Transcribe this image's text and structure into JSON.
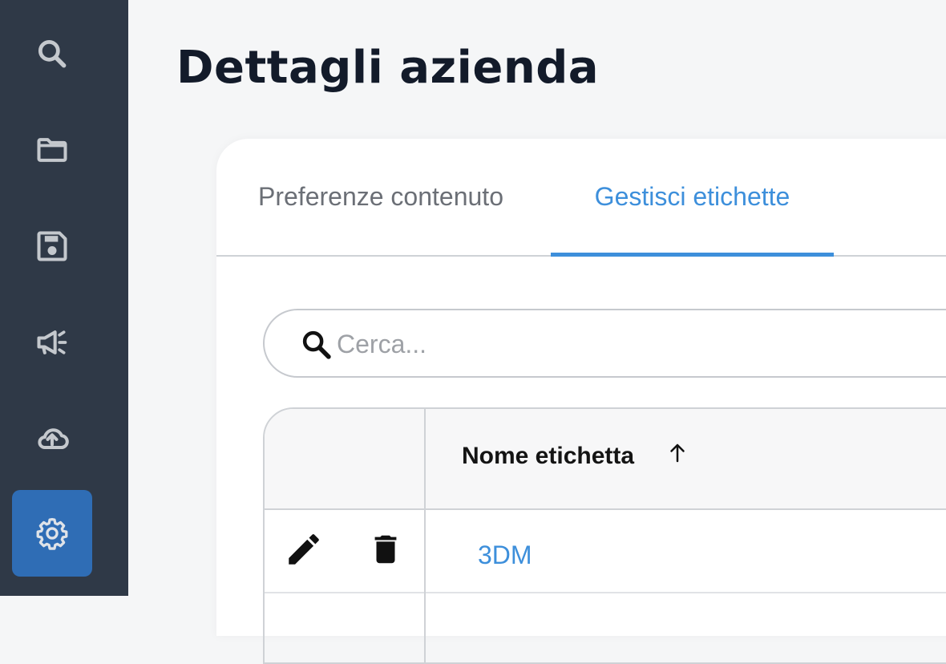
{
  "sidebar": {
    "items": [
      {
        "icon": "search-icon",
        "active": false
      },
      {
        "icon": "folder-icon",
        "active": false
      },
      {
        "icon": "save-icon",
        "active": false
      },
      {
        "icon": "megaphone-icon",
        "active": false
      },
      {
        "icon": "cloud-upload-icon",
        "active": false
      },
      {
        "icon": "gear-icon",
        "active": true
      }
    ],
    "colors": {
      "background": "#2f3947",
      "active": "#2f6db5",
      "icon": "#c4c8cd"
    }
  },
  "page": {
    "title": "Dettagli azienda"
  },
  "tabs": [
    {
      "label": "Preferenze contenuto",
      "active": false
    },
    {
      "label": "Gestisci etichette",
      "active": true
    }
  ],
  "search": {
    "placeholder": "Cerca...",
    "value": ""
  },
  "table": {
    "columns": [
      "",
      "Nome etichetta"
    ],
    "sort": "ascending",
    "rows": [
      {
        "name": "3DM"
      }
    ]
  },
  "colors": {
    "accent": "#3d8fdb",
    "title": "#131b2a"
  }
}
